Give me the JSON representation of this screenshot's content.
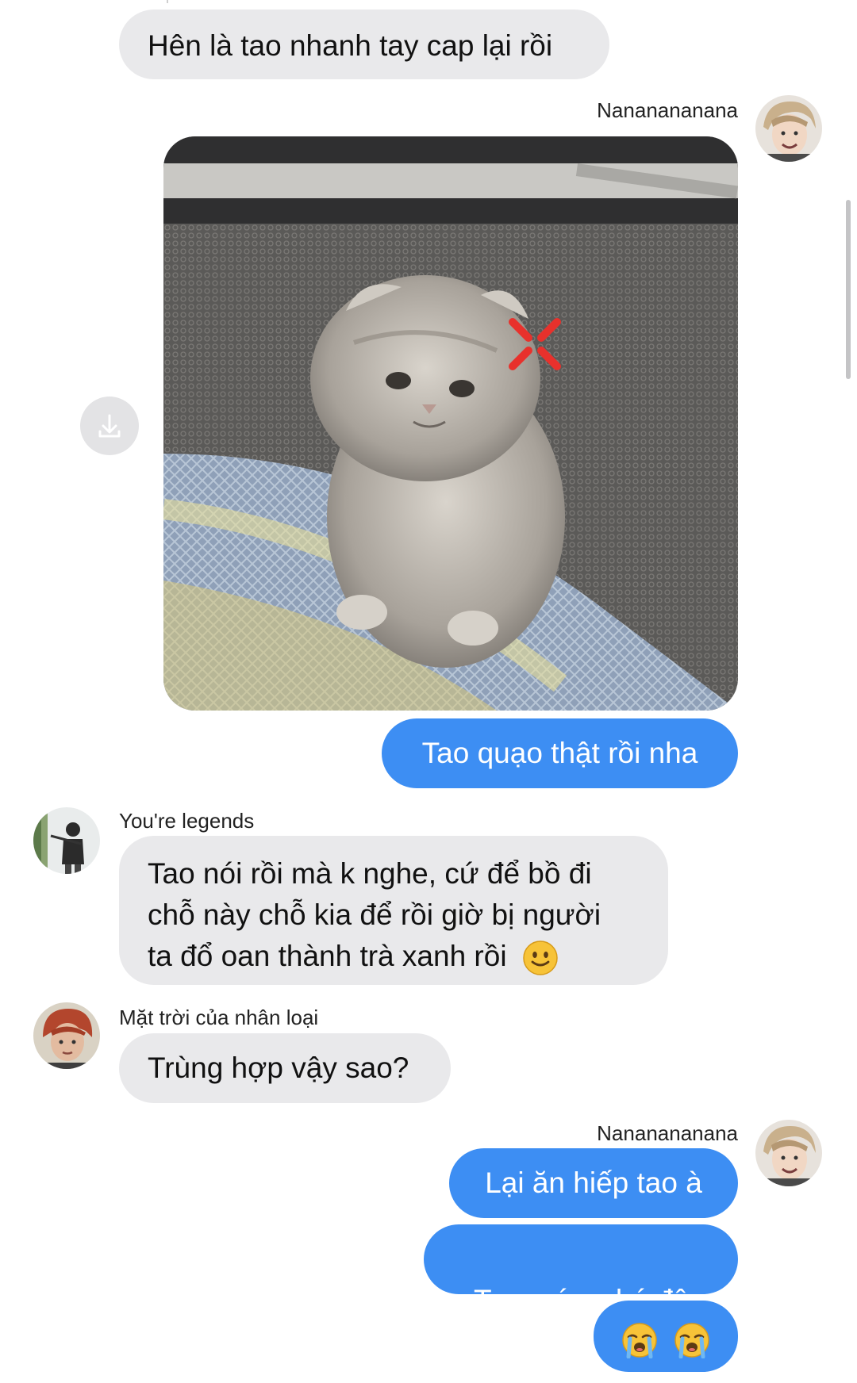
{
  "messages": {
    "m1": {
      "text": "Hên là tao nhanh tay cap lại rồi"
    },
    "sender_nana_1": "Nananananana",
    "m2": {
      "text": "Tao quạo thật rồi nha"
    },
    "sender_legends": "You're legends",
    "m3": {
      "line1": "Tao nói rồi mà k nghe, cứ để bồ đi",
      "line2": "chỗ này chỗ kia để rồi giờ bị người",
      "line3": "ta đổ oan thành trà xanh rồi",
      "emoji": "slightly-smiling-face"
    },
    "sender_sun": "Mặt trời của nhân loại",
    "m4": {
      "text": "Trùng hợp vậy sao?"
    },
    "sender_nana_2": "Nananananana",
    "m5": {
      "text": "Lại ăn hiếp tao à"
    },
    "m6": {
      "text": "Tao méc  chú đây"
    },
    "m7": {
      "emoji": [
        "loudly-crying-face",
        "loudly-crying-face"
      ]
    }
  },
  "colors": {
    "outgoing_bubble": "#3d8ef3",
    "incoming_bubble": "#e9e9eb"
  },
  "icons": {
    "download": "download-icon"
  }
}
